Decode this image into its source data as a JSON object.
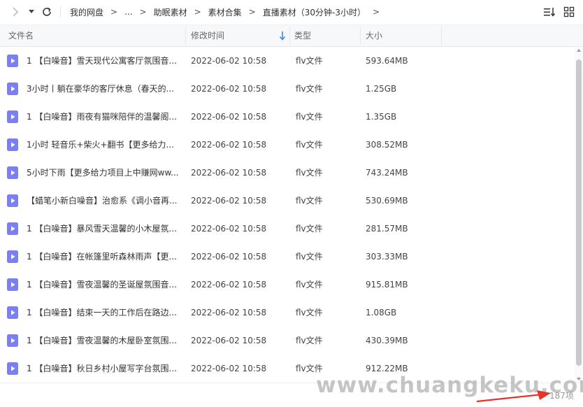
{
  "breadcrumb": {
    "items": [
      "我的网盘",
      "...",
      "助眠素材",
      "素材合集",
      "直播素材（30分钟-3小时）"
    ]
  },
  "columns": {
    "name": "文件名",
    "modified": "修改时间",
    "type": "类型",
    "size": "大小"
  },
  "files": [
    {
      "name": "1 【白噪音】雪天现代公寓客厅氛围音...",
      "modified": "2022-06-02 10:58",
      "type": "flv文件",
      "size": "593.64MB"
    },
    {
      "name": "3小时丨躺在豪华的客厅休息（春天的...",
      "modified": "2022-06-02 10:58",
      "type": "flv文件",
      "size": "1.25GB"
    },
    {
      "name": "1 【白噪音】雨夜有猫咪陪伴的温馨阁...",
      "modified": "2022-06-02 10:58",
      "type": "flv文件",
      "size": "1.35GB"
    },
    {
      "name": "1小时 轻音乐+柴火+翻书【更多给力...",
      "modified": "2022-06-02 10:58",
      "type": "flv文件",
      "size": "308.52MB"
    },
    {
      "name": "5小时下雨【更多给力项目上中赚网ww...",
      "modified": "2022-06-02 10:58",
      "type": "flv文件",
      "size": "743.24MB"
    },
    {
      "name": "【蜡笔小新白噪音】治愈系《调小音再...",
      "modified": "2022-06-02 10:58",
      "type": "flv文件",
      "size": "530.69MB"
    },
    {
      "name": "1 【白噪音】暴风雪天温馨的小木屋氛...",
      "modified": "2022-06-02 10:58",
      "type": "flv文件",
      "size": "281.57MB"
    },
    {
      "name": "1 【白噪音】在帐篷里听森林雨声【更...",
      "modified": "2022-06-02 10:58",
      "type": "flv文件",
      "size": "303.33MB"
    },
    {
      "name": "1 【白噪音】雪夜温馨的圣诞屋氛围音...",
      "modified": "2022-06-02 10:58",
      "type": "flv文件",
      "size": "915.81MB"
    },
    {
      "name": "1 【白噪音】结束一天的工作后在路边...",
      "modified": "2022-06-02 10:58",
      "type": "flv文件",
      "size": "1.08GB"
    },
    {
      "name": "1 【白噪音】雪夜温馨的木屋卧室氛围...",
      "modified": "2022-06-02 10:58",
      "type": "flv文件",
      "size": "430.39MB"
    },
    {
      "name": "1 【白噪音】秋日乡村小屋写字台氛围...",
      "modified": "2022-06-02 10:58",
      "type": "flv文件",
      "size": "912.22MB"
    }
  ],
  "footer": {
    "count": "187项",
    "watermark": "www.chuangkeku.com"
  },
  "icons": {
    "file": "video-file-icon",
    "back": "chevron-right-icon",
    "dropdown": "caret-down-icon",
    "refresh": "refresh-icon",
    "sort": "sort-list-icon",
    "grid": "grid-view-icon"
  },
  "colors": {
    "file_icon": "#7b7ff0",
    "sort_arrow": "#3a8ee6",
    "red_arrow": "#e8322c"
  }
}
